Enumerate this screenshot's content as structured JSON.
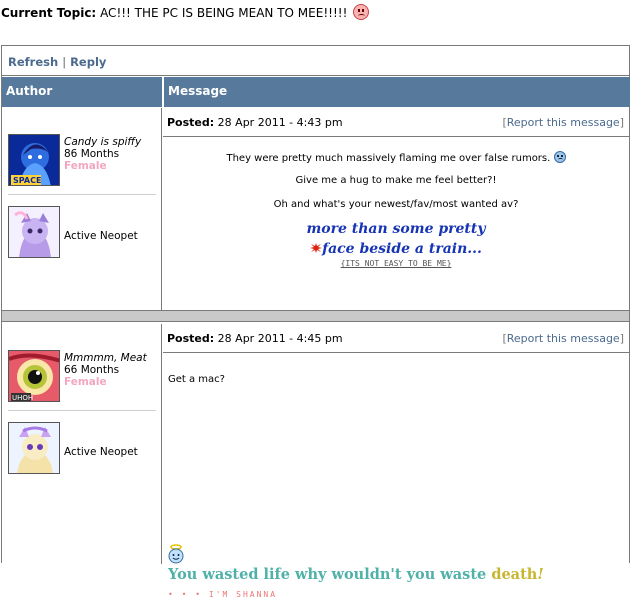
{
  "topic": {
    "label": "Current Topic:",
    "title": "AC!!! THE PC IS BEING MEAN TO MEE!!!!!"
  },
  "actions": {
    "refresh": "Refresh",
    "separator": "|",
    "reply": "Reply"
  },
  "headers": {
    "author": "Author",
    "message": "Message"
  },
  "posts": [
    {
      "posted_label": "Posted:",
      "posted_date": "28 Apr 2011 - 4:43 pm",
      "report": "Report this message",
      "user": {
        "name": "Candy is spiffy",
        "months": "86 Months",
        "gender": "Female"
      },
      "pet_status": "Active Neopet",
      "lines": [
        "They were pretty much massively flaming me over false rumors.",
        "Give me a hug to make me feel better?!",
        "Oh and what's your newest/fav/most wanted av?"
      ],
      "signature": {
        "line1": "more than some pretty",
        "line2": "face beside a train...",
        "line3": "{ITS NOT EASY TO BE ME}"
      }
    },
    {
      "posted_label": "Posted:",
      "posted_date": "28 Apr 2011 - 4:45 pm",
      "report": "Report this message",
      "user": {
        "name": "Mmmmm, Meat",
        "months": "66 Months",
        "gender": "Female"
      },
      "pet_status": "Active Neopet",
      "lines": [
        "Get a mac?"
      ],
      "signature": {
        "main_a": "You wasted life why wouldn't you waste ",
        "main_death": "death",
        "main_bang": "!",
        "tag": "• • • I'M SHANNA"
      }
    }
  ],
  "colors": {
    "header_bg": "#56799c",
    "link": "#4b6a8e",
    "gender": "#f3a7bf",
    "sig_blue": "#1634b4",
    "sig_teal": "#4fb1a8",
    "sig_gold": "#c8b631"
  },
  "icons": [
    "frown-icon",
    "sad-face-icon",
    "halo-smiley-icon",
    "splat-icon"
  ]
}
